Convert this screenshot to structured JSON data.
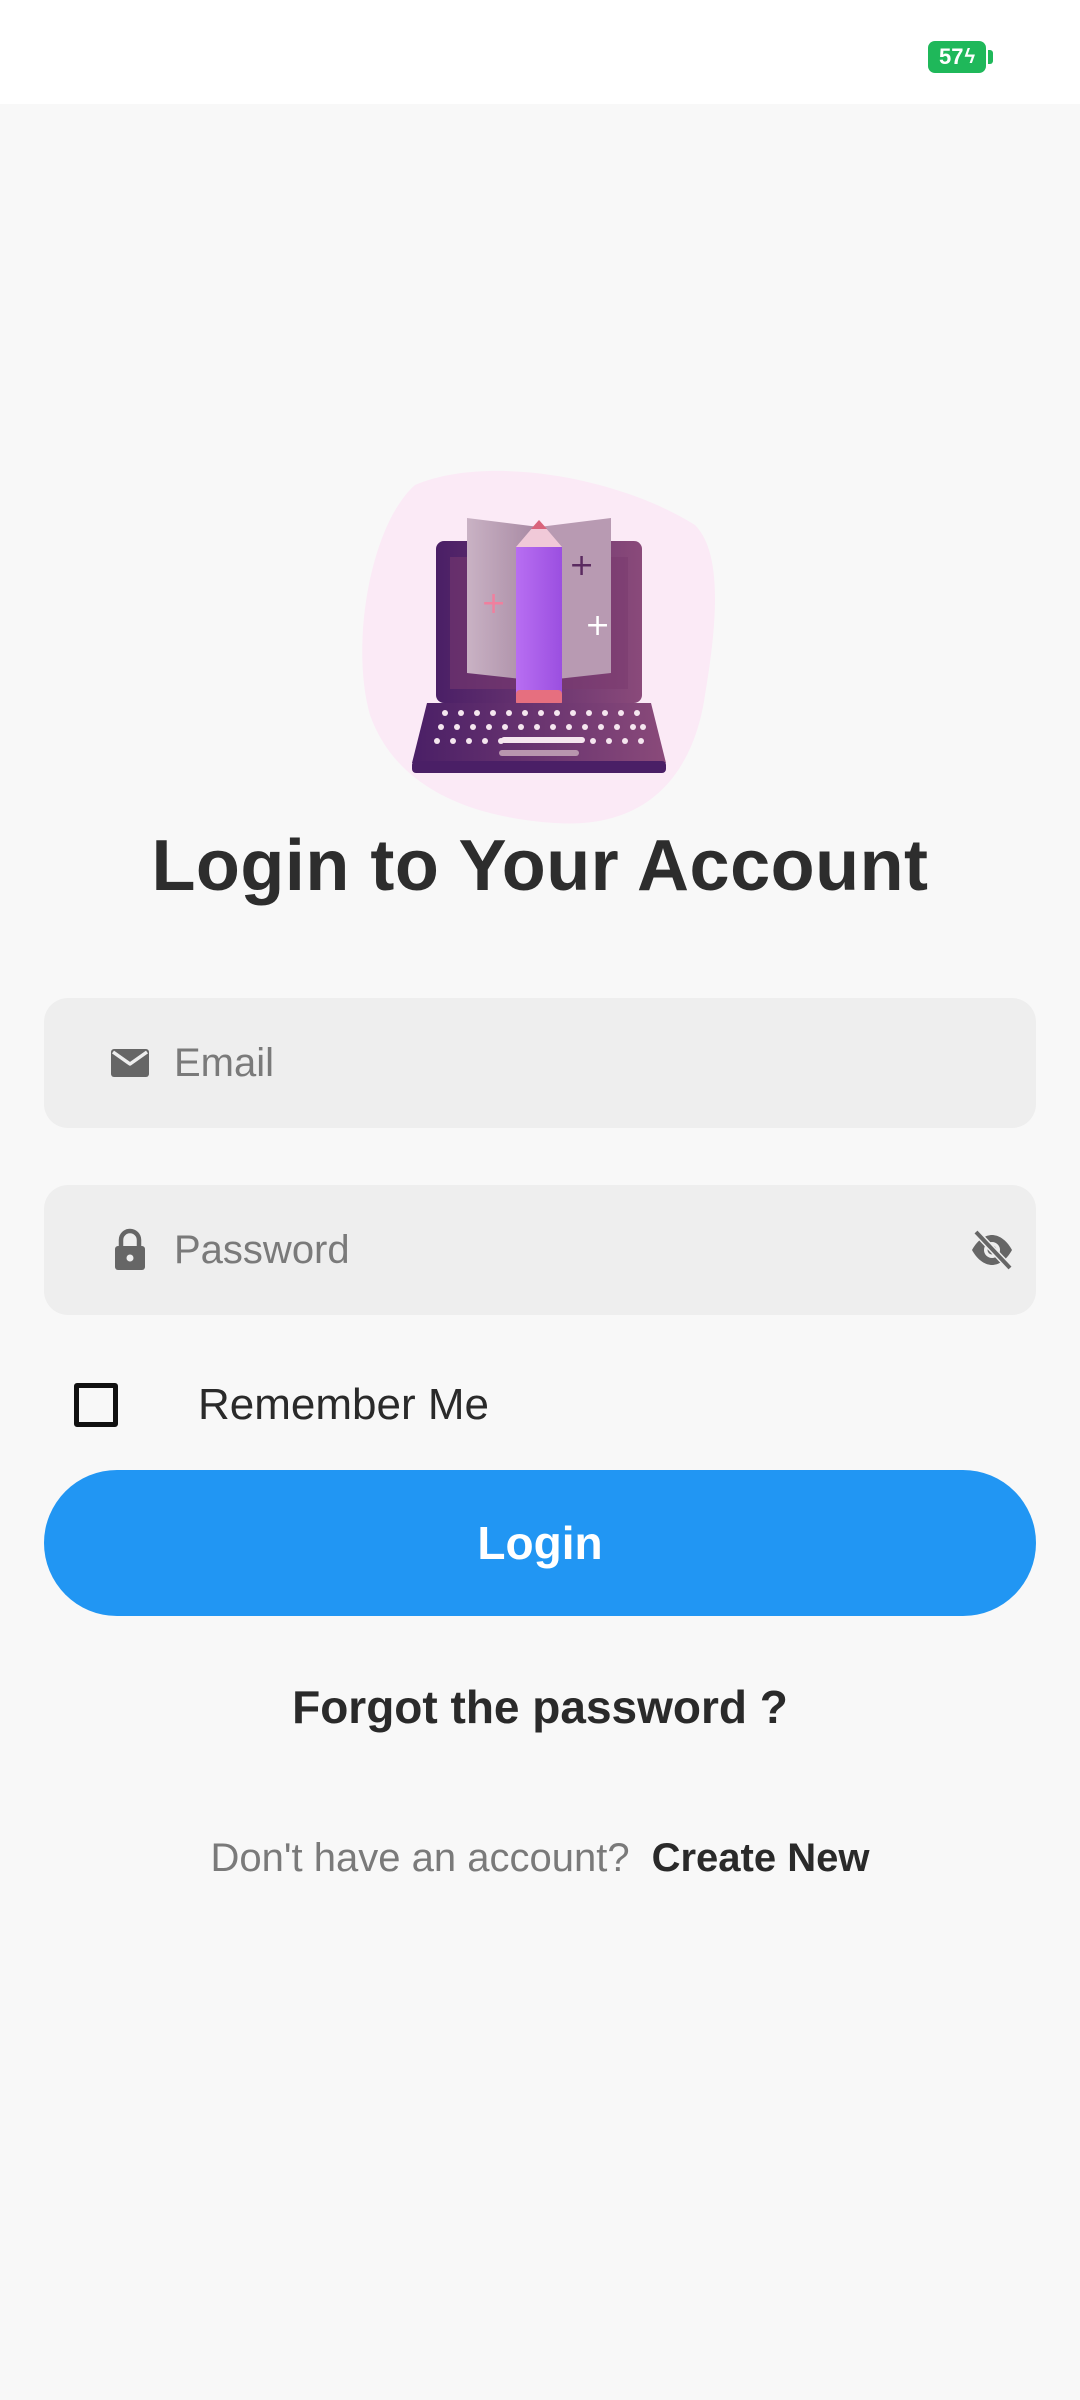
{
  "status_bar": {
    "battery_level": "57",
    "battery_color": "#1fb85a"
  },
  "illustration": {
    "name": "laptop-book-pencil-illustration"
  },
  "title": "Login to Your Account",
  "email": {
    "placeholder": "Email",
    "icon": "email-icon"
  },
  "password": {
    "placeholder": "Password",
    "icon": "lock-icon",
    "toggle_icon": "eye-off-icon"
  },
  "remember": {
    "label": "Remember Me",
    "checked": false
  },
  "login_button": {
    "label": "Login",
    "color": "#2196f3"
  },
  "forgot_password": "Forgot the password ?",
  "signup": {
    "prompt": "Don't have an account?",
    "link": "Create New"
  }
}
